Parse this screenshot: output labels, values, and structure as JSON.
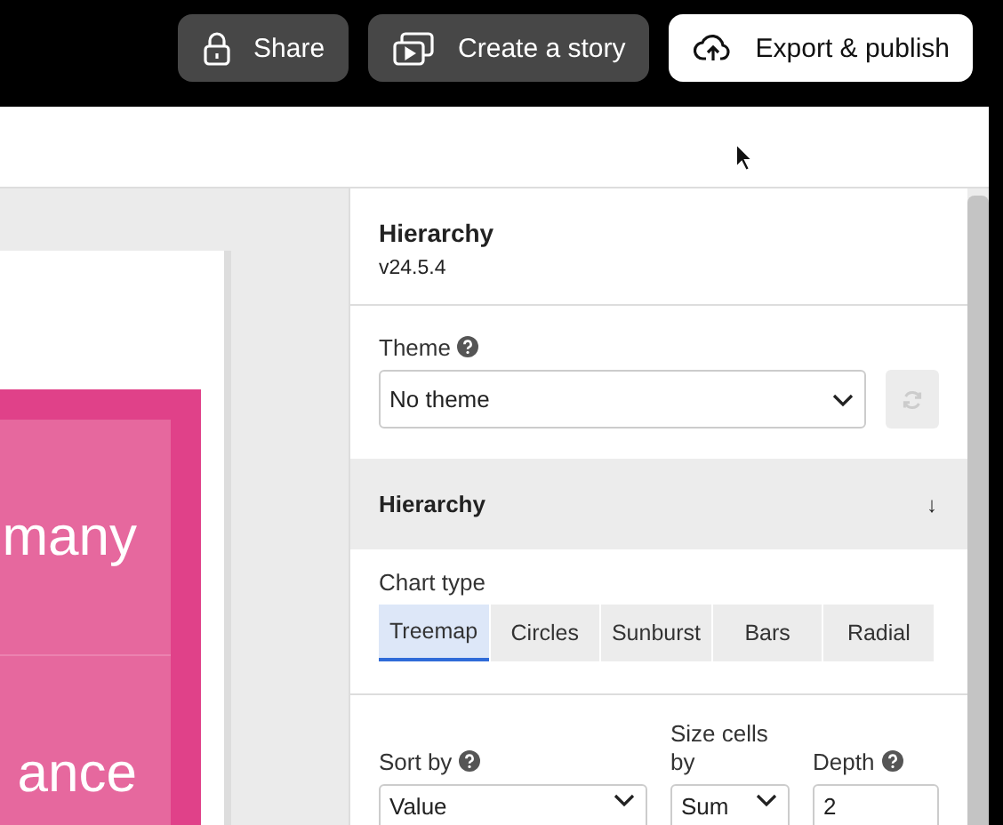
{
  "toolbar": {
    "buttons": [
      {
        "kind": "share",
        "label": "Share"
      },
      {
        "kind": "story",
        "label": "Create a story"
      },
      {
        "kind": "export",
        "label": "Export & publish"
      }
    ]
  },
  "canvas": {
    "cells": [
      {
        "label": "many"
      },
      {
        "label": "ance"
      }
    ]
  },
  "panel": {
    "title": "Hierarchy",
    "version": "v24.5.4",
    "theme": {
      "label": "Theme",
      "value": "No theme"
    },
    "section": {
      "title": "Hierarchy",
      "toggle": "↓"
    },
    "chart_type": {
      "label": "Chart type",
      "options": [
        {
          "label": "Treemap",
          "selected": true
        },
        {
          "label": "Circles",
          "selected": false
        },
        {
          "label": "Sunburst",
          "selected": false
        },
        {
          "label": "Bars",
          "selected": false
        },
        {
          "label": "Radial",
          "selected": false
        }
      ]
    },
    "fields": [
      {
        "kind": "select",
        "label": "Sort by",
        "help": true,
        "value": "Value"
      },
      {
        "kind": "select",
        "label": "Size cells by",
        "help": false,
        "value": "Sum"
      },
      {
        "kind": "input",
        "label": "Depth",
        "help": true,
        "value": "2"
      }
    ]
  }
}
